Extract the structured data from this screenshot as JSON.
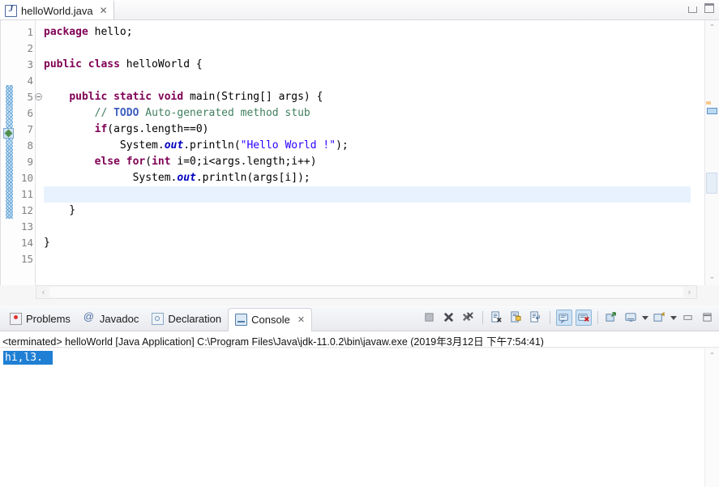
{
  "window": {
    "minimize_label": "Minimize",
    "maximize_label": "Maximize"
  },
  "editor": {
    "tab": {
      "icon": "java-file-icon",
      "title": "helloWorld.java",
      "close": "✕"
    },
    "line_numbers": [
      "1",
      "2",
      "3",
      "4",
      "5",
      "6",
      "7",
      "8",
      "9",
      "10",
      "11",
      "12",
      "13",
      "14",
      "15"
    ],
    "current_line": 11,
    "fold_marker_line": 5,
    "code_lines": [
      {
        "n": 1,
        "tokens": [
          {
            "t": "package ",
            "c": "kw"
          },
          {
            "t": "hello;",
            "c": "pln"
          }
        ]
      },
      {
        "n": 2,
        "tokens": []
      },
      {
        "n": 3,
        "tokens": [
          {
            "t": "public class ",
            "c": "kw"
          },
          {
            "t": "helloWorld {",
            "c": "pln"
          }
        ]
      },
      {
        "n": 4,
        "tokens": []
      },
      {
        "n": 5,
        "tokens": [
          {
            "t": "    ",
            "c": "pln"
          },
          {
            "t": "public static void ",
            "c": "kw"
          },
          {
            "t": "main(String[] args) {",
            "c": "pln"
          }
        ]
      },
      {
        "n": 6,
        "tokens": [
          {
            "t": "        ",
            "c": "pln"
          },
          {
            "t": "// ",
            "c": "cmt"
          },
          {
            "t": "TODO",
            "c": "todo"
          },
          {
            "t": " Auto-generated method stub",
            "c": "cmt"
          }
        ]
      },
      {
        "n": 7,
        "tokens": [
          {
            "t": "        ",
            "c": "pln"
          },
          {
            "t": "if",
            "c": "kw"
          },
          {
            "t": "(args.length==0)",
            "c": "pln"
          }
        ]
      },
      {
        "n": 8,
        "tokens": [
          {
            "t": "            System.",
            "c": "pln"
          },
          {
            "t": "out",
            "c": "fld"
          },
          {
            "t": ".println(",
            "c": "pln"
          },
          {
            "t": "\"Hello World !\"",
            "c": "str"
          },
          {
            "t": ");",
            "c": "pln"
          }
        ]
      },
      {
        "n": 9,
        "tokens": [
          {
            "t": "        ",
            "c": "pln"
          },
          {
            "t": "else for",
            "c": "kw"
          },
          {
            "t": "(",
            "c": "pln"
          },
          {
            "t": "int",
            "c": "kw"
          },
          {
            "t": " i=0;i<args.length;i++)",
            "c": "pln"
          }
        ]
      },
      {
        "n": 10,
        "tokens": [
          {
            "t": "              System.",
            "c": "pln"
          },
          {
            "t": "out",
            "c": "fld"
          },
          {
            "t": ".println(args[i]);",
            "c": "pln"
          }
        ]
      },
      {
        "n": 11,
        "tokens": []
      },
      {
        "n": 12,
        "tokens": [
          {
            "t": "    }",
            "c": "pln"
          }
        ]
      },
      {
        "n": 13,
        "tokens": []
      },
      {
        "n": 14,
        "tokens": [
          {
            "t": "}",
            "c": "pln"
          }
        ]
      },
      {
        "n": 15,
        "tokens": []
      }
    ],
    "scroll": {
      "up_arrow": "⌃",
      "down_arrow": "⌄",
      "left_arrow": "‹",
      "right_arrow": "›"
    }
  },
  "console_panel": {
    "tabs": [
      {
        "label": "Problems",
        "icon": "problems-icon",
        "active": false
      },
      {
        "label": "Javadoc",
        "icon": "javadoc-at-icon",
        "active": false
      },
      {
        "label": "Declaration",
        "icon": "declaration-icon",
        "active": false
      },
      {
        "label": "Console",
        "icon": "console-icon",
        "active": true,
        "close": "✕"
      }
    ],
    "toolbar": [
      {
        "name": "terminate-button",
        "pressed": false
      },
      {
        "name": "remove-launch-button",
        "pressed": false
      },
      {
        "name": "remove-all-launches-button",
        "pressed": false
      },
      {
        "name": "clear-console-button",
        "pressed": false
      },
      {
        "name": "scroll-lock-button",
        "pressed": false
      },
      {
        "name": "word-wrap-button",
        "pressed": false
      },
      {
        "name": "show-console-on-output-button",
        "pressed": true
      },
      {
        "name": "show-console-on-error-button",
        "pressed": true
      },
      {
        "name": "pin-console-button",
        "pressed": false
      },
      {
        "name": "display-selected-console-button",
        "pressed": false
      },
      {
        "name": "display-console-dropdown",
        "pressed": false
      },
      {
        "name": "open-console-button",
        "pressed": false
      },
      {
        "name": "open-console-dropdown",
        "pressed": false
      },
      {
        "name": "minimize-panel-button",
        "pressed": false
      },
      {
        "name": "maximize-panel-button",
        "pressed": false
      }
    ],
    "header": "<terminated> helloWorld [Java Application] C:\\Program Files\\Java\\jdk-11.0.2\\bin\\javaw.exe (2019年3月12日 下午7:54:41)",
    "output": "hi,l3.",
    "scroll": {
      "up_arrow": "⌃"
    }
  },
  "colors": {
    "keyword": "#7F0055",
    "string": "#2A00FF",
    "comment": "#3F7F5F",
    "todo": "#3F5FBF",
    "static_field": "#0000C0",
    "current_line_bg": "#E8F2FE",
    "selection_bg": "#1F7FD4",
    "tab_active_bg": "#FFFFFF"
  }
}
